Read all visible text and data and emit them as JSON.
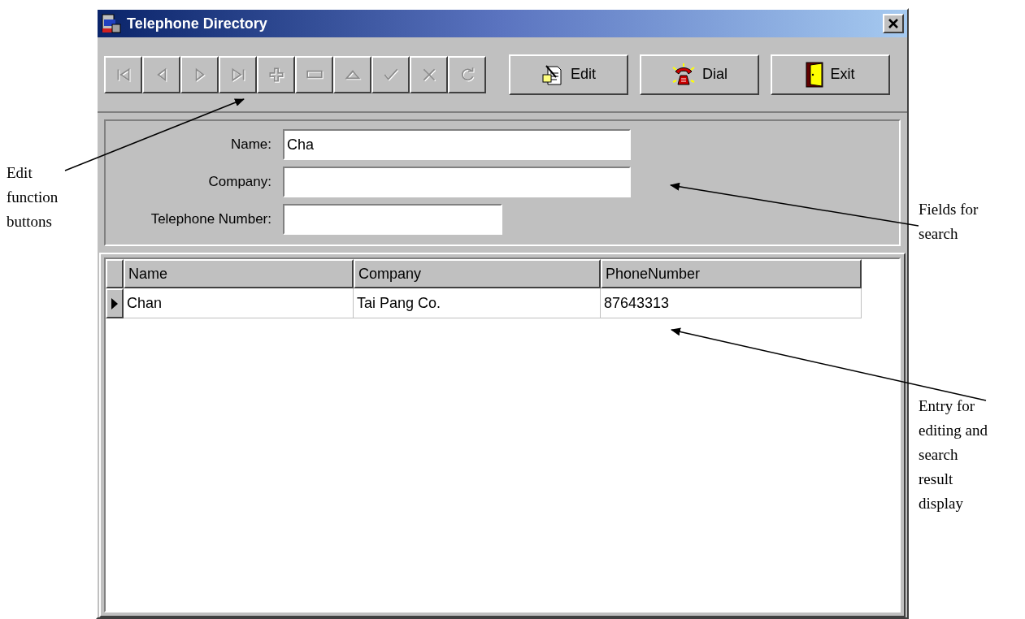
{
  "window": {
    "title": "Telephone Directory"
  },
  "toolbar": {
    "nav_buttons": [
      {
        "kind": "first",
        "disabled": true
      },
      {
        "kind": "prior",
        "disabled": true
      },
      {
        "kind": "next",
        "disabled": true
      },
      {
        "kind": "last",
        "disabled": true
      },
      {
        "kind": "insert",
        "disabled": true
      },
      {
        "kind": "delete",
        "disabled": true
      },
      {
        "kind": "edit",
        "disabled": true
      },
      {
        "kind": "post",
        "disabled": true
      },
      {
        "kind": "cancel",
        "disabled": true
      },
      {
        "kind": "refresh",
        "disabled": true
      }
    ],
    "buttons": [
      {
        "kind": "edit",
        "label": "Edit"
      },
      {
        "kind": "dial",
        "label": "Dial"
      },
      {
        "kind": "exit",
        "label": "Exit"
      }
    ]
  },
  "search": {
    "fields": [
      {
        "label": "Name:",
        "value": "Cha",
        "kind": "wide"
      },
      {
        "label": "Company:",
        "kind": "wide"
      },
      {
        "label": "Telephone Number:",
        "kind": "narrow"
      }
    ]
  },
  "grid": {
    "columns": [
      "Name",
      "Company",
      "PhoneNumber"
    ],
    "rows": [
      {
        "cells": [
          "Chan",
          "Tai Pang Co.",
          "87643313"
        ],
        "selected": true
      }
    ]
  },
  "annotations": [
    {
      "text": "Edit function buttons"
    },
    {
      "text": "Fields for search"
    },
    {
      "text": "Entry for editing and search result display"
    }
  ]
}
